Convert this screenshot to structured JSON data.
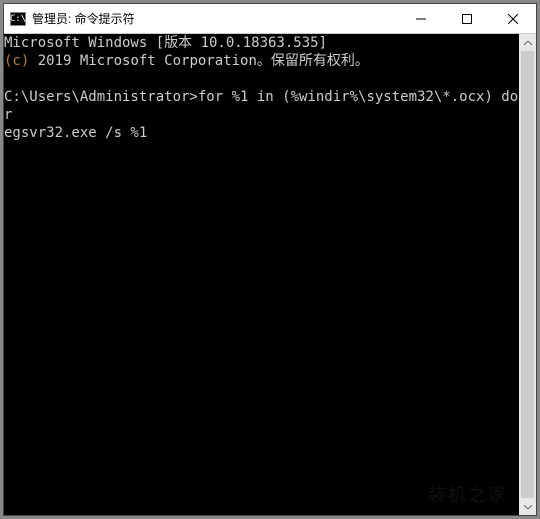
{
  "window": {
    "icon_label": "C:\\",
    "title": "管理员: 命令提示符"
  },
  "terminal": {
    "line1": "Microsoft Windows [版本 10.0.18363.535]",
    "copyright_symbol": "(c)",
    "line2_rest": " 2019 Microsoft Corporation。保留所有权利。",
    "prompt": "C:\\Users\\Administrator>",
    "command_part1": "for %1 in (%windir%\\system32\\*.ocx) do r",
    "command_part2": "egsvr32.exe /s %1"
  },
  "watermark": "装机之家"
}
